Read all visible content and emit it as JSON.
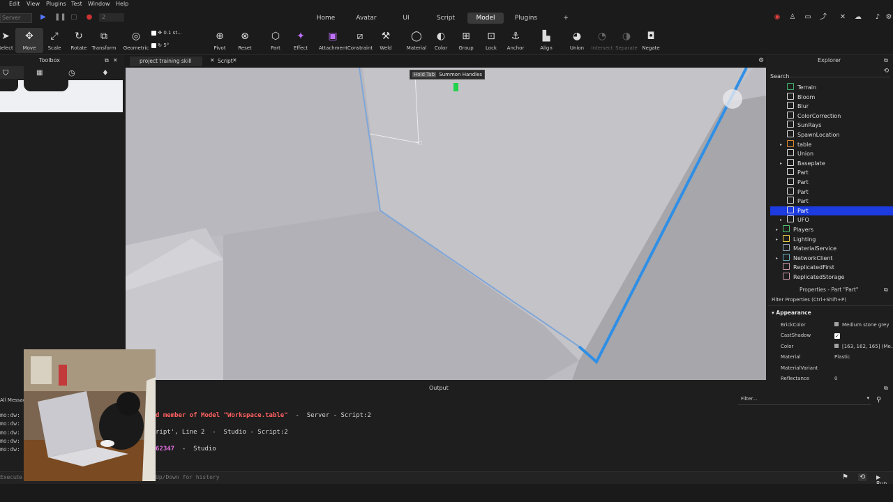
{
  "menu": [
    "Edit",
    "View",
    "Plugins",
    "Test",
    "Window",
    "Help"
  ],
  "server_select": "Server",
  "player_count": "2",
  "main_tabs": [
    "Home",
    "Avatar",
    "UI",
    "Script",
    "Model",
    "Plugins"
  ],
  "active_tab": "Model",
  "add_tab": "+",
  "ribbon": {
    "select": "Select",
    "move": "Move",
    "scale": "Scale",
    "rotate": "Rotate",
    "transform": "Transform",
    "geometric": "Geometric",
    "move_step": "0.1 st...",
    "rotate_step": "5°",
    "pivot": "Pivot",
    "reset": "Reset",
    "part": "Part",
    "effect": "Effect",
    "attachment": "Attachment",
    "constraint": "Constraint",
    "weld": "Weld",
    "material": "Material",
    "color": "Color",
    "group": "Group",
    "lock": "Lock",
    "anchor": "Anchor",
    "align": "Align",
    "union": "Union",
    "intersect": "Intersect",
    "separate": "Separate",
    "negate": "Negate"
  },
  "toolbox": {
    "title": "Toolbox"
  },
  "doc_tabs": [
    {
      "label": "project training skill"
    },
    {
      "label": "Script"
    }
  ],
  "viewport": {
    "hint_key": "Hold Tab",
    "hint_text": "Summon Handles"
  },
  "explorer": {
    "title": "Explorer",
    "search_placeholder": "Search",
    "items": [
      {
        "label": "Terrain",
        "icon": "terrain-icon",
        "color": "#3fb36b"
      },
      {
        "label": "Bloom",
        "icon": "effect-icon",
        "color": "#d9d9d9"
      },
      {
        "label": "Blur",
        "icon": "drop-icon",
        "color": "#d9d9d9"
      },
      {
        "label": "ColorCorrection",
        "icon": "gear-icon",
        "color": "#d9d9d9"
      },
      {
        "label": "SunRays",
        "icon": "sun-icon",
        "color": "#d9d9d9"
      },
      {
        "label": "SpawnLocation",
        "icon": "spawn-icon",
        "color": "#d9d9d9"
      },
      {
        "label": "table",
        "icon": "model-icon",
        "color": "#e08a2e"
      },
      {
        "label": "Union",
        "icon": "union-icon",
        "color": "#d9d9d9"
      },
      {
        "label": "Baseplate",
        "icon": "part-icon",
        "color": "#d9d9d9"
      },
      {
        "label": "Part",
        "icon": "part-icon",
        "color": "#d9d9d9"
      },
      {
        "label": "Part",
        "icon": "part-icon",
        "color": "#d9d9d9"
      },
      {
        "label": "Part",
        "icon": "part-icon",
        "color": "#d9d9d9"
      },
      {
        "label": "Part",
        "icon": "part-icon",
        "color": "#d9d9d9"
      },
      {
        "label": "Part",
        "icon": "part-icon",
        "color": "#d9d9d9"
      },
      {
        "label": "UFO",
        "icon": "part-icon",
        "color": "#d9d9d9"
      },
      {
        "label": "Players",
        "icon": "players-icon",
        "color": "#4fc36b"
      },
      {
        "label": "Lighting",
        "icon": "lightbulb-icon",
        "color": "#f0d040"
      },
      {
        "label": "MaterialService",
        "icon": "material-icon",
        "color": "#9ab"
      },
      {
        "label": "NetworkClient",
        "icon": "network-icon",
        "color": "#6ab"
      },
      {
        "label": "ReplicatedFirst",
        "icon": "replicated-icon",
        "color": "#c9a"
      },
      {
        "label": "ReplicatedStorage",
        "icon": "storage-icon",
        "color": "#c9a"
      }
    ],
    "selected_index": 13
  },
  "properties": {
    "title": "Properties - Part \"Part\"",
    "filter_placeholder": "Filter Properties (Ctrl+Shift+P)",
    "section": "Appearance",
    "rows": [
      {
        "name": "BrickColor",
        "value": "Medium stone grey",
        "swatch": "#a3a2a5"
      },
      {
        "name": "CastShadow",
        "value": "",
        "checkbox": true
      },
      {
        "name": "Color",
        "value": "[163, 162, 165] (Me...",
        "swatch": "#a3a2a5"
      },
      {
        "name": "Material",
        "value": "Plastic"
      },
      {
        "name": "MaterialVariant",
        "value": ""
      },
      {
        "name": "Reflectance",
        "value": "0"
      }
    ]
  },
  "output": {
    "title": "Output",
    "filter_placeholder": "Filter...",
    "left_tab": "All Messages",
    "lines": [
      {
        "parts": [
          {
            "t": "d member of Model \"Workspace.table\"",
            "c": "#ff6060",
            "b": true
          },
          {
            "t": "  -  Server - Script:2",
            "c": "#d6d6d6",
            "b": false
          }
        ]
      },
      {
        "parts": [
          {
            "t": "ript', Line 2",
            "c": "#d6d6d6",
            "b": false
          },
          {
            "t": "  -  Studio - Script:2",
            "c": "#d6d6d6",
            "b": false
          }
        ]
      },
      {
        "parts": [
          {
            "t": "62347",
            "c": "#e070e0",
            "b": true
          },
          {
            "t": "  -  Studio",
            "c": "#d6d6d6",
            "b": false
          }
        ]
      }
    ],
    "side_lines": [
      "mo:dw:",
      "mo:dw:",
      "mo:dw:",
      "mo:dw:",
      "mo:dw:"
    ]
  },
  "command_bar": {
    "prefix": "Execute",
    "hint": "Up/Down for history",
    "run": "Run"
  },
  "colors": {
    "selection": "#1c3be0",
    "active_tab": "#3a3a3a",
    "accent_blue": "#2f8fe6",
    "error_red": "#ff6060"
  }
}
